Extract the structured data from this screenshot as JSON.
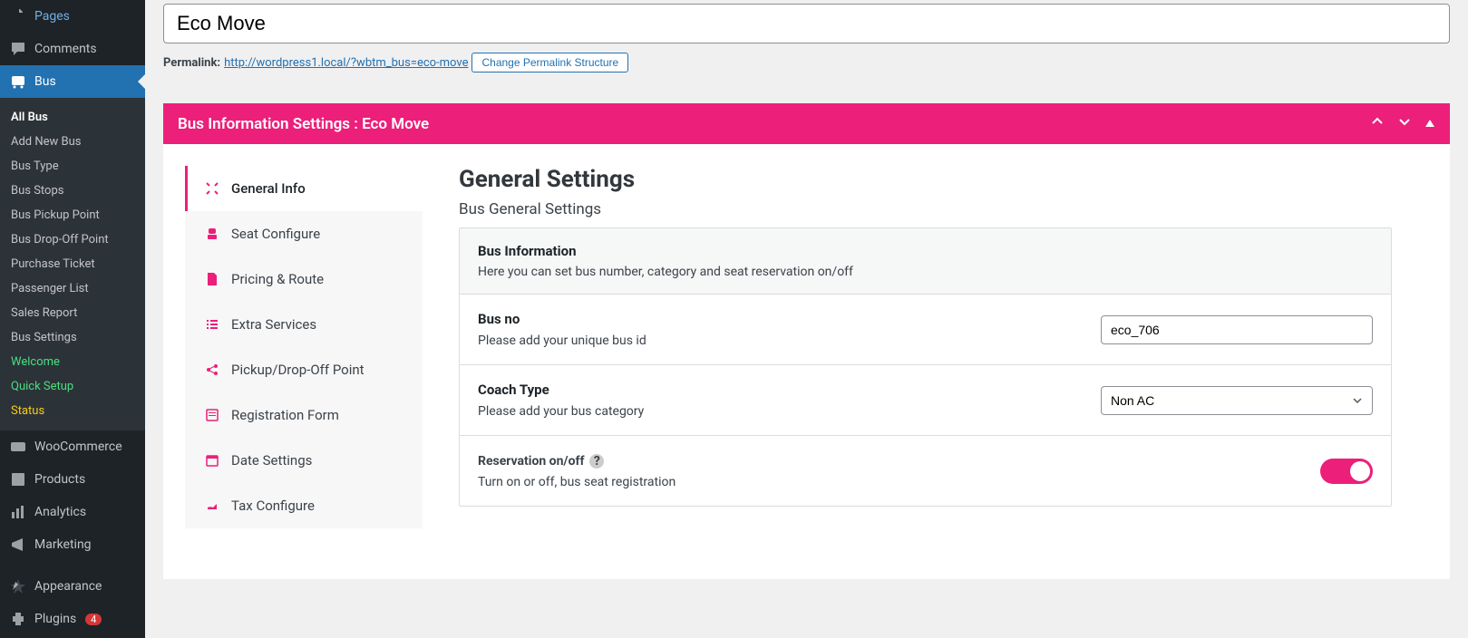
{
  "sidebar": {
    "pages": "Pages",
    "comments": "Comments",
    "bus": "Bus",
    "submenu": {
      "all_bus": "All Bus",
      "add_new": "Add New Bus",
      "bus_type": "Bus Type",
      "bus_stops": "Bus Stops",
      "pickup": "Bus Pickup Point",
      "dropoff": "Bus Drop-Off Point",
      "purchase": "Purchase Ticket",
      "passenger": "Passenger List",
      "sales": "Sales Report",
      "settings": "Bus Settings",
      "welcome": "Welcome",
      "quick": "Quick Setup",
      "status": "Status"
    },
    "woo": "WooCommerce",
    "products": "Products",
    "analytics": "Analytics",
    "marketing": "Marketing",
    "appearance": "Appearance",
    "plugins": "Plugins",
    "plugins_count": "4"
  },
  "title": "Eco Move",
  "permalink": {
    "label": "Permalink:",
    "url": "http://wordpress1.local/?wbtm_bus=eco-move",
    "button": "Change Permalink Structure"
  },
  "panel": {
    "title": "Bus Information Settings : Eco Move"
  },
  "tabs": {
    "general": "General Info",
    "seat": "Seat Configure",
    "pricing": "Pricing & Route",
    "extra": "Extra Services",
    "pickup": "Pickup/Drop-Off Point",
    "registration": "Registration Form",
    "date": "Date Settings",
    "tax": "Tax Configure"
  },
  "content": {
    "heading": "General Settings",
    "subtitle": "Bus General Settings",
    "card_title": "Bus Information",
    "card_desc": "Here you can set bus number, category and seat reservation on/off",
    "bus_no_label": "Bus no",
    "bus_no_desc": "Please add your unique bus id",
    "bus_no_value": "eco_706",
    "coach_label": "Coach Type",
    "coach_desc": "Please add your bus category",
    "coach_value": "Non AC",
    "reservation_label": "Reservation on/off",
    "reservation_desc": "Turn on or off, bus seat registration"
  }
}
